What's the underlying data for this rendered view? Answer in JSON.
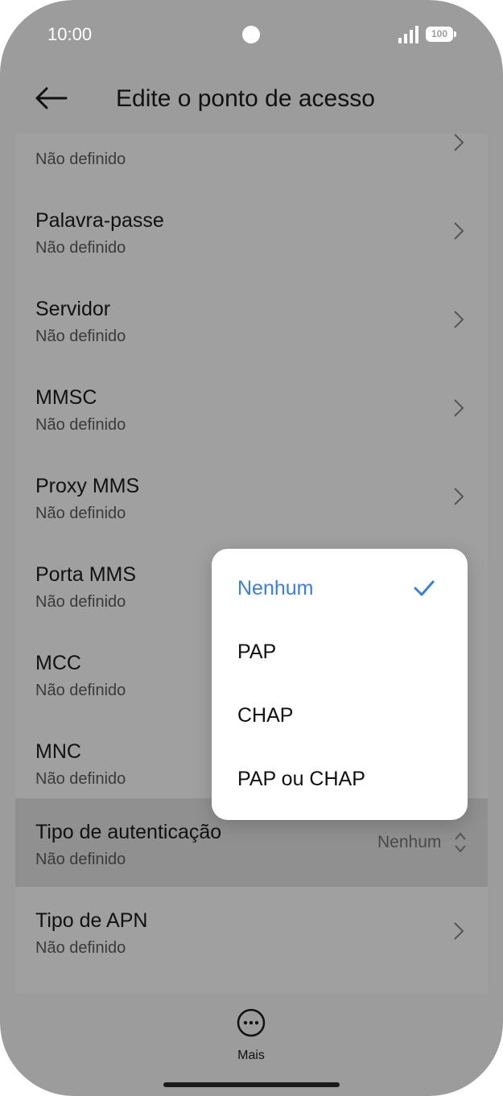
{
  "status_bar": {
    "time": "10:00",
    "battery": "100"
  },
  "header": {
    "title": "Edite o ponto de acesso"
  },
  "settings": [
    {
      "label": "",
      "value": "Não definido"
    },
    {
      "label": "Palavra-passe",
      "value": "Não definido"
    },
    {
      "label": "Servidor",
      "value": "Não definido"
    },
    {
      "label": "MMSC",
      "value": "Não definido"
    },
    {
      "label": "Proxy MMS",
      "value": "Não definido"
    },
    {
      "label": "Porta MMS",
      "value": "Não definido"
    },
    {
      "label": "MCC",
      "value": "Não definido"
    },
    {
      "label": "MNC",
      "value": "Não definido"
    },
    {
      "label": "Tipo de autenticação",
      "value": "Não definido",
      "selected": "Nenhum"
    },
    {
      "label": "Tipo de APN",
      "value": "Não definido"
    }
  ],
  "dropdown": {
    "options": [
      "Nenhum",
      "PAP",
      "CHAP",
      "PAP ou CHAP"
    ],
    "selected_index": 0
  },
  "bottom_bar": {
    "more_label": "Mais"
  },
  "colors": {
    "accent": "#3a7fdc",
    "dim_background": "#9c9c9c",
    "highlight_row": "#909090"
  }
}
